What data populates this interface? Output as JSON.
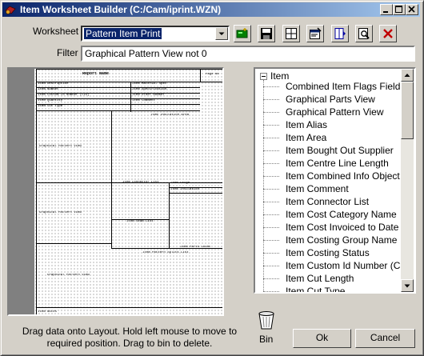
{
  "window": {
    "title": "Item Worksheet Builder (C:/Cam/iprint.WZN)",
    "controls": [
      "minimize",
      "maximize",
      "close"
    ]
  },
  "worksheet": {
    "label": "Worksheet",
    "selected": "Pattern Item Print"
  },
  "toolbar": {
    "icons": [
      "new-worksheet-icon",
      "save-icon",
      "layout-grid-icon",
      "properties-icon",
      "columns-icon",
      "print-preview-icon",
      "delete-icon"
    ]
  },
  "filter": {
    "label": "Filter",
    "value": "Graphical Pattern View not 0"
  },
  "layout": {
    "header_title": "Report Name",
    "header_page": "Page No",
    "fields": [
      "Item Description",
      "Item Material Spec",
      "Item Number",
      "Item Specification",
      "Item Custom Id Number (CID)",
      "Item Order Number",
      "Item Quantity",
      "Item Comment",
      "Item Cut Type",
      "Item Insulation Area",
      "Graphical Pattern View",
      "Item Connector List",
      "Item Gauge",
      "Item Insulation",
      "Graphical Pattern View",
      "Item Seam List",
      "Item Parts Count",
      "Item Pattern Splits List",
      "Graphical Pattern View",
      "Item Notes"
    ]
  },
  "tree": {
    "root": "Item",
    "items": [
      "Combined Item Flags Field",
      "Graphical Parts View",
      "Graphical Pattern View",
      "Item Alias",
      "Item Area",
      "Item Bought Out Supplier",
      "Item Centre Line Length",
      "Item Combined Info Object",
      "Item Comment",
      "Item Connector List",
      "Item Cost Category Name",
      "Item Cost Invoiced to Date",
      "Item Costing Group Name",
      "Item Costing Status",
      "Item Custom Id Number (CID)",
      "Item Cut Length",
      "Item Cut Type"
    ]
  },
  "help_text": "Drag data onto Layout. Hold left mouse to move to required position. Drag to bin to delete.",
  "bin": {
    "label": "Bin"
  },
  "buttons": {
    "ok": "Ok",
    "cancel": "Cancel"
  },
  "colors": {
    "title_start": "#0a246a",
    "title_end": "#a6caf0",
    "selection": "#0a246a",
    "face": "#d4d0c8"
  }
}
